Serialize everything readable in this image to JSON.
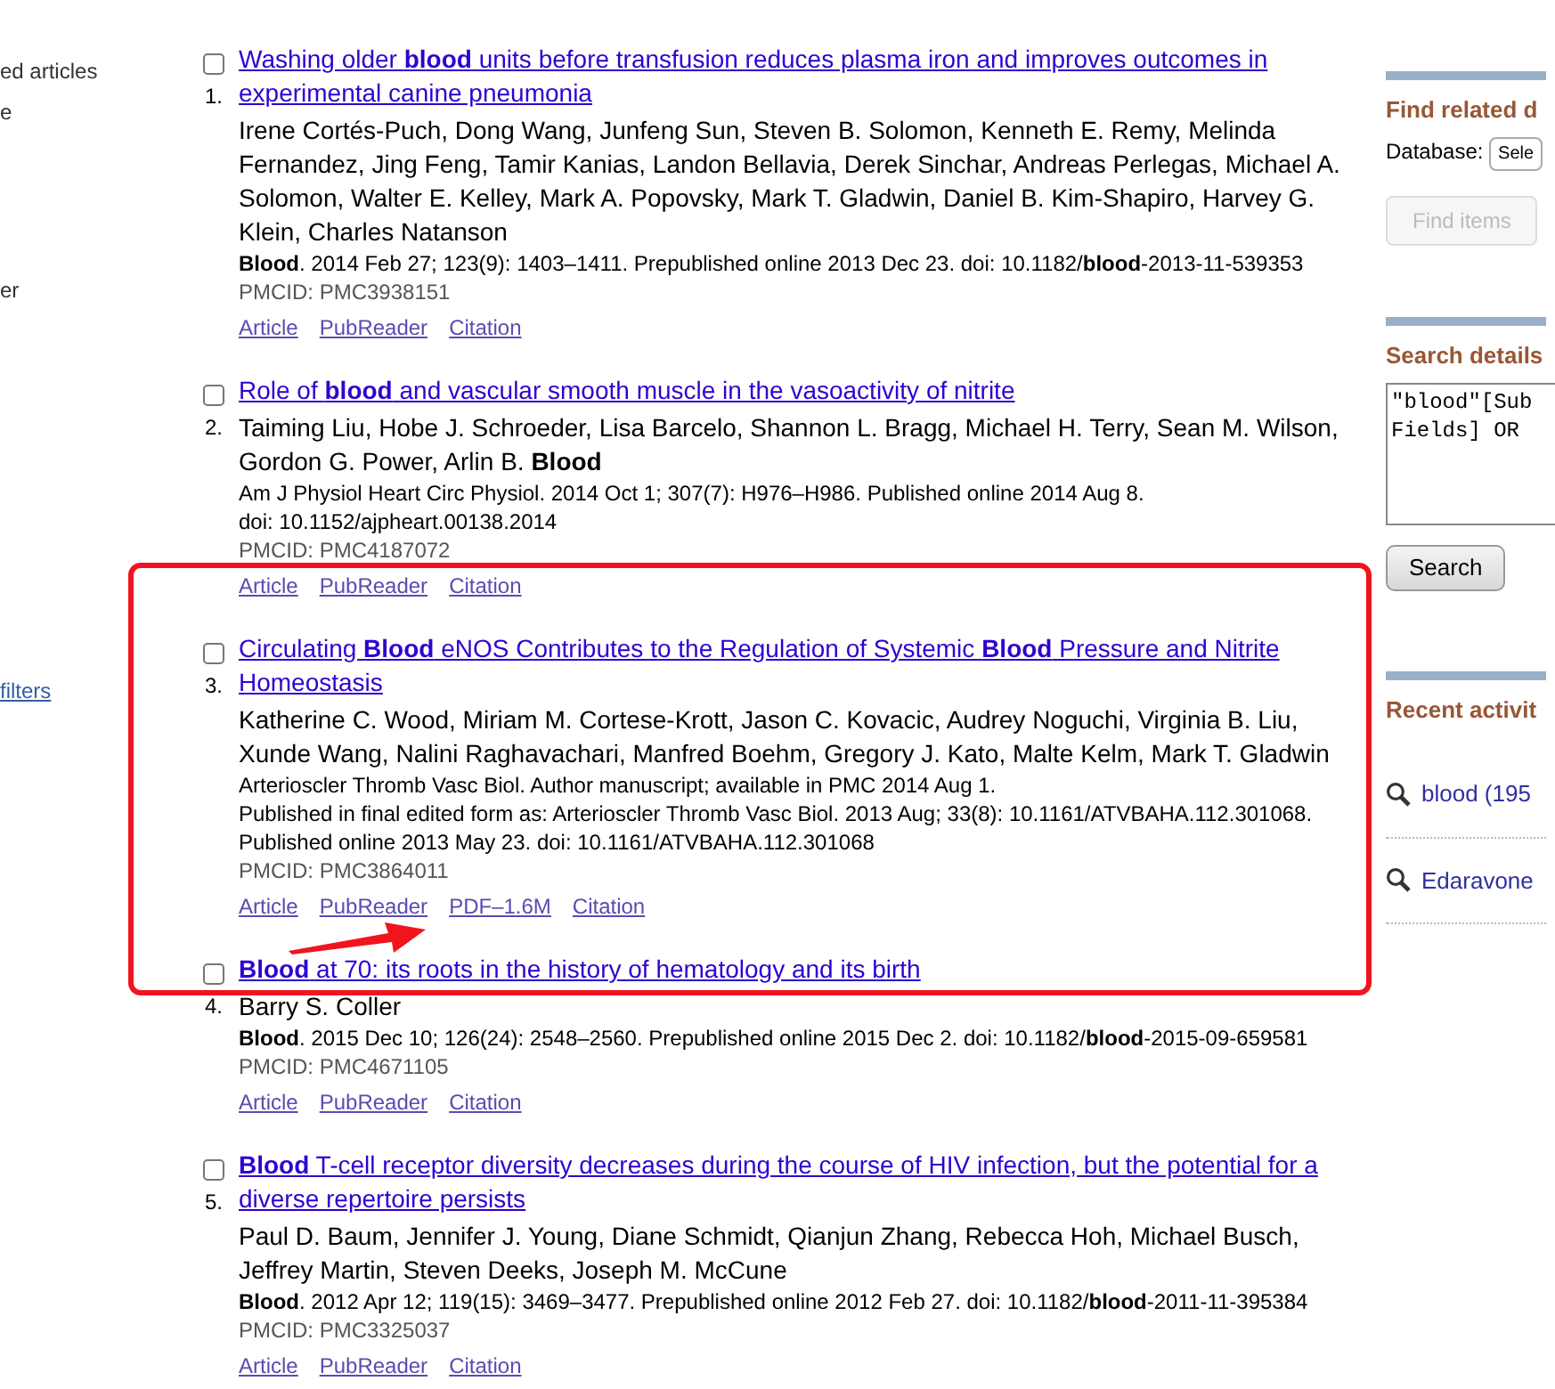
{
  "left_sidebar": {
    "items": [
      {
        "text": "ed articles",
        "kind": "text"
      },
      {
        "text": "e",
        "kind": "text"
      },
      {
        "text": "er",
        "kind": "text"
      },
      {
        "text": "filters",
        "kind": "link"
      }
    ]
  },
  "results": [
    {
      "number": "1.",
      "checked": false,
      "title": "Washing older **blood** units before transfusion reduces plasma iron and improves outcomes in experimental canine pneumonia",
      "authors": "Irene Cortés-Puch, Dong Wang, Junfeng Sun, Steven B. Solomon, Kenneth E. Remy, Melinda Fernandez, Jing Feng, Tamir Kanias, Landon Bellavia, Derek Sinchar, Andreas Perlegas, Michael A. Solomon, Walter E. Kelley, Mark A. Popovsky, Mark T. Gladwin, Daniel B. Kim-Shapiro, Harvey G. Klein, Charles Natanson",
      "citation": [
        "**Blood**. 2014 Feb 27; 123(9): 1403–1411. Prepublished online 2013 Dec 23. doi: 10.1182/**blood**-2013-11-539353"
      ],
      "pmcid": "PMCID: PMC3938151",
      "links": [
        "Article",
        "PubReader",
        "Citation"
      ]
    },
    {
      "number": "2.",
      "checked": false,
      "title": "Role of **blood** and vascular smooth muscle in the vasoactivity of nitrite",
      "authors": "Taiming Liu, Hobe J. Schroeder, Lisa Barcelo, Shannon L. Bragg, Michael H. Terry, Sean M. Wilson, Gordon G. Power, Arlin B. **Blood**",
      "citation": [
        "Am J Physiol Heart Circ Physiol. 2014 Oct 1; 307(7): H976–H986. Published online 2014 Aug 8.",
        "doi: 10.1152/ajpheart.00138.2014"
      ],
      "pmcid": "PMCID: PMC4187072",
      "links": [
        "Article",
        "PubReader",
        "Citation"
      ]
    },
    {
      "number": "3.",
      "checked": false,
      "title": "Circulating **Blood** eNOS Contributes to the Regulation of Systemic **Blood** Pressure and Nitrite Homeostasis",
      "authors": "Katherine C. Wood, Miriam M. Cortese-Krott, Jason C. Kovacic, Audrey Noguchi, Virginia B. Liu, Xunde Wang, Nalini Raghavachari, Manfred Boehm, Gregory J. Kato, Malte Kelm, Mark T. Gladwin",
      "citation": [
        "Arterioscler Thromb Vasc Biol. Author manuscript; available in PMC 2014 Aug 1.",
        "Published in final edited form as: Arterioscler Thromb Vasc Biol. 2013 Aug; 33(8): 10.1161/ATVBAHA.112.301068.",
        "Published online 2013 May 23. doi: 10.1161/ATVBAHA.112.301068"
      ],
      "pmcid": "PMCID: PMC3864011",
      "links": [
        "Article",
        "PubReader",
        "PDF–1.6M",
        "Citation"
      ]
    },
    {
      "number": "4.",
      "checked": false,
      "title": "**Blood** at 70: its roots in the history of hematology and its birth",
      "authors": "Barry S. Coller",
      "citation": [
        "**Blood**. 2015 Dec 10; 126(24): 2548–2560. Prepublished online 2015 Dec 2. doi: 10.1182/**blood**-2015-09-659581"
      ],
      "pmcid": "PMCID: PMC4671105",
      "links": [
        "Article",
        "PubReader",
        "Citation"
      ]
    },
    {
      "number": "5.",
      "checked": false,
      "title": "**Blood** T-cell receptor diversity decreases during the course of HIV infection, but the potential for a diverse repertoire persists",
      "authors": "Paul D. Baum, Jennifer J. Young, Diane Schmidt, Qianjun Zhang, Rebecca Hoh, Michael Busch, Jeffrey Martin, Steven Deeks, Joseph M. McCune",
      "citation": [
        "**Blood**. 2012 Apr 12; 119(15): 3469–3477. Prepublished online 2012 Feb 27. doi: 10.1182/**blood**-2011-11-395384"
      ],
      "pmcid": "PMCID: PMC3325037",
      "links": [
        "Article",
        "PubReader",
        "Citation"
      ]
    }
  ],
  "highlight_box": true,
  "pointer_arrow": true,
  "right_sidebar": {
    "find_related": {
      "heading": "Find related d",
      "database_label": "Database:",
      "select_value": "Sele",
      "button": "Find items",
      "button_disabled": true
    },
    "search_details": {
      "heading": "Search details",
      "query": "\"blood\"[Sub\nFields] OR",
      "button": "Search"
    },
    "recent_activity": {
      "heading": "Recent activit",
      "items": [
        "blood (195",
        "Edaravone"
      ]
    }
  }
}
